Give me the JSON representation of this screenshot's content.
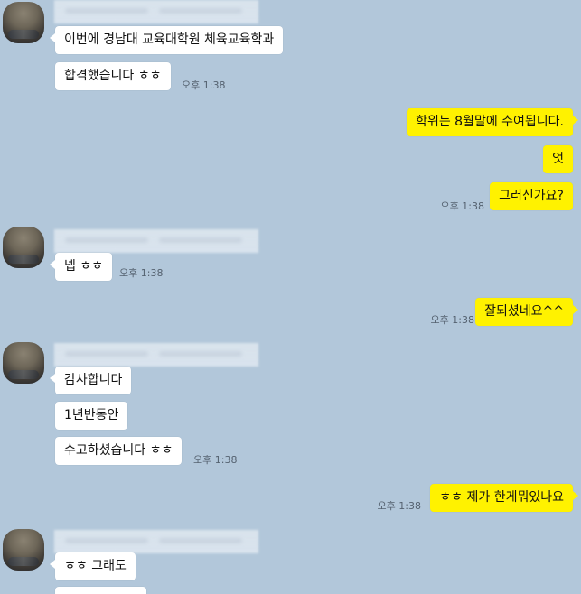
{
  "colors": {
    "background": "#b2c7da",
    "incoming_bubble": "#ffffff",
    "outgoing_bubble": "#fff200",
    "timestamp": "#556270"
  },
  "chat": {
    "messages": [
      {
        "text": "이번에 경남대 교육대학원 체육교육학과"
      },
      {
        "text": "합격했습니다 ㅎㅎ",
        "time": "오후 1:38"
      },
      {
        "text": "학위는 8월말에 수여됩니다."
      },
      {
        "text": "엇"
      },
      {
        "text": "그러신가요?",
        "time": "오후 1:38"
      },
      {
        "text": "넵 ㅎㅎ",
        "time": "오후 1:38"
      },
      {
        "text": "잘되셨네요^^",
        "time": "오후 1:38"
      },
      {
        "text": "감사합니다"
      },
      {
        "text": "1년반동안"
      },
      {
        "text": "수고하셨습니다 ㅎㅎ",
        "time": "오후 1:38"
      },
      {
        "text": "ㅎㅎ 제가 한게뭐있나요",
        "time": "오후 1:38"
      },
      {
        "text": "ㅎㅎ 그래도"
      }
    ]
  }
}
